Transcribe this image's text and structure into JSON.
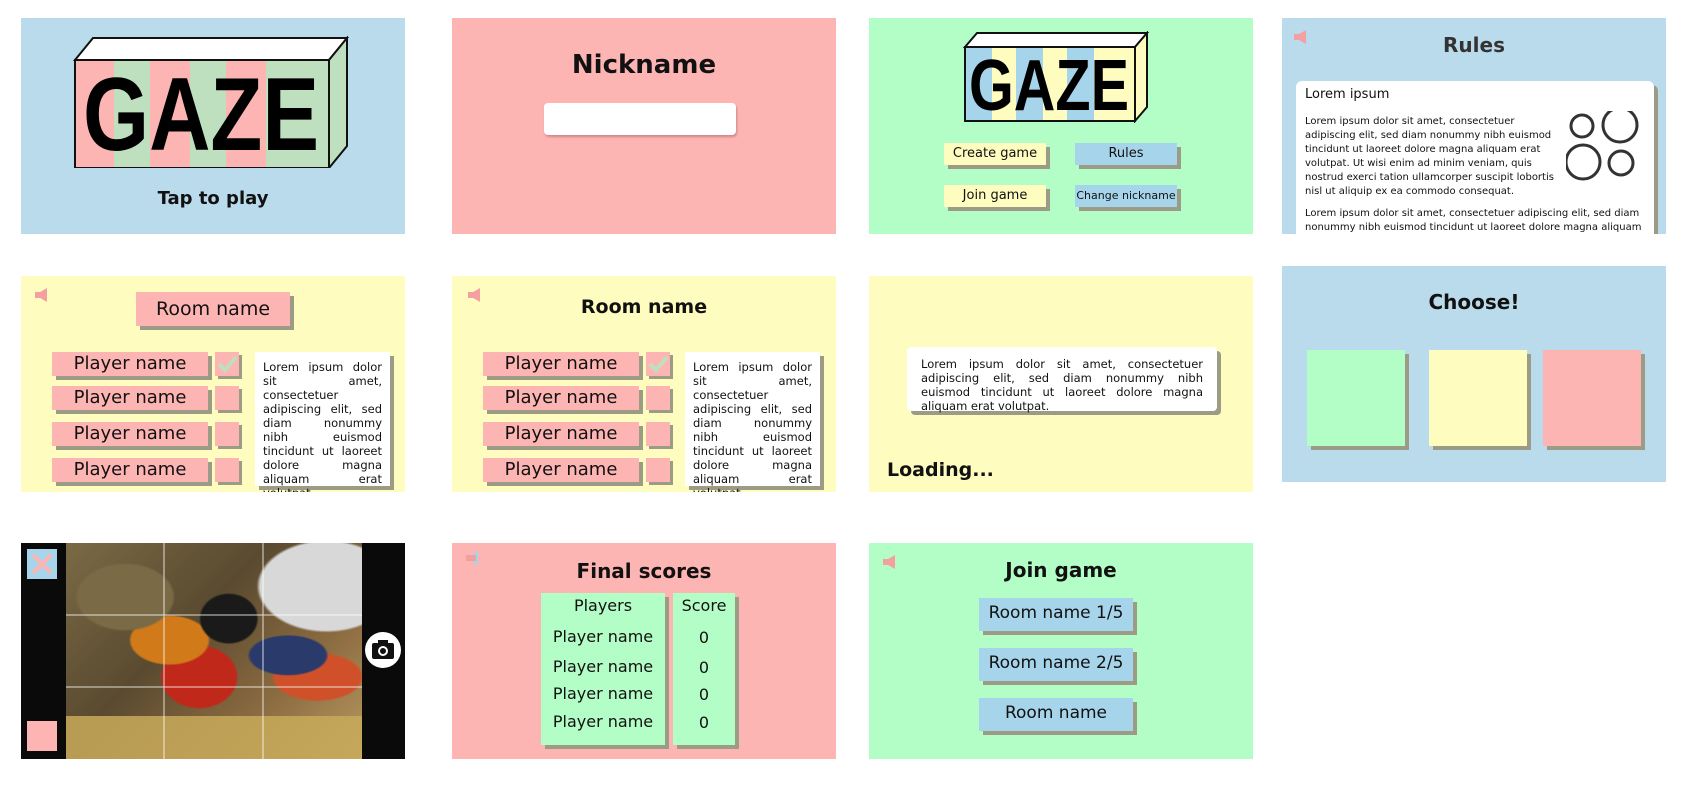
{
  "colors": {
    "blue": "#badbeb",
    "pink": "#fdb5b3",
    "green": "#b3fdc6",
    "yellow": "#fffcc0",
    "shadow": "#9c9c86"
  },
  "splash": {
    "logo": "GAZE",
    "tap": "Tap to play"
  },
  "nickname": {
    "title": "Nickname",
    "input_value": ""
  },
  "menu": {
    "logo": "GAZE",
    "create": "Create game",
    "rules": "Rules",
    "join": "Join game",
    "change": "Change nickname"
  },
  "rules": {
    "title": "Rules",
    "heading": "Lorem ipsum",
    "para1": "Lorem ipsum dolor sit amet, consectetuer adipiscing elit, sed diam nonummy nibh euismod tincidunt ut laoreet dolore magna aliquam erat volutpat. Ut wisi enim ad minim veniam, quis nostrud exerci tation ullamcorper suscipit lobortis nisl ut aliquip ex ea commodo consequat.",
    "para2": "Lorem ipsum dolor sit amet, consectetuer adipiscing elit, sed diam nonummy nibh euismod tincidunt ut laoreet dolore magna aliquam"
  },
  "lobby_host": {
    "room": "Room name",
    "players": [
      "Player name",
      "Player name",
      "Player name",
      "Player name"
    ],
    "text": "Lorem ipsum dolor sit amet, consectetuer adipiscing elit, sed diam nonummy nibh euismod tincidunt ut laoreet dolore magna aliquam erat volutpat."
  },
  "lobby_guest": {
    "room": "Room name",
    "players": [
      "Player name",
      "Player name",
      "Player name",
      "Player name"
    ],
    "text": "Lorem ipsum dolor sit amet, consectetuer adipiscing elit, sed diam nonummy nibh euismod tincidunt ut laoreet dolore magna aliquam erat volutpat."
  },
  "loading": {
    "text": "Lorem ipsum dolor sit amet, consectetuer adipiscing elit, sed diam nonummy nibh euismod tincidunt ut laoreet dolore magna aliquam erat volutpat.",
    "label": "Loading..."
  },
  "choose": {
    "title": "Choose!"
  },
  "camera": {
    "close_icon": "close-icon",
    "shutter_icon": "camera-icon"
  },
  "scores": {
    "title": "Final scores",
    "col_players": "Players",
    "col_score": "Score",
    "rows": [
      {
        "name": "Player name",
        "score": "0"
      },
      {
        "name": "Player name",
        "score": "0"
      },
      {
        "name": "Player name",
        "score": "0"
      },
      {
        "name": "Player name",
        "score": "0"
      }
    ]
  },
  "join": {
    "title": "Join game",
    "rooms": [
      "Room name 1/5",
      "Room name 2/5",
      "Room name"
    ]
  }
}
